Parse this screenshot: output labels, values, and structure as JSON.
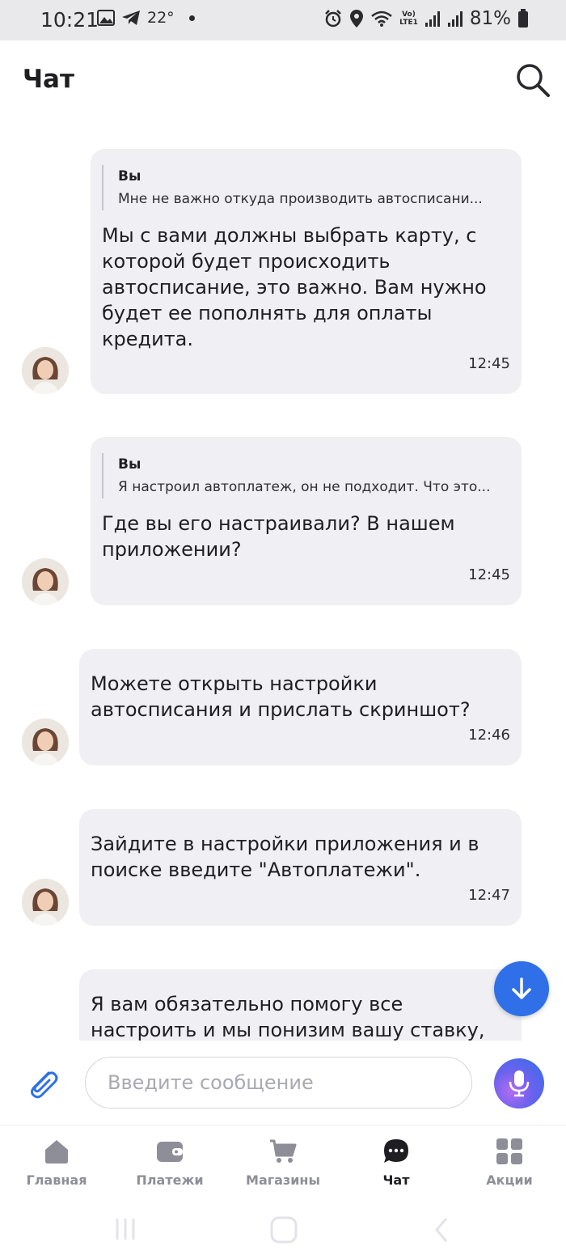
{
  "status_bar": {
    "time": "10:21",
    "temperature": "22°",
    "network_top": "Vo)",
    "network_bottom": "LTE1",
    "battery": "81%"
  },
  "header": {
    "title": "Чат",
    "search_icon": "search-icon"
  },
  "messages": [
    {
      "reply": {
        "author": "Вы",
        "text": "Мне не важно откуда производить автосписани..."
      },
      "text": "Мы с вами должны выбрать карту, с которой будет происходить автосписание, это важно. Вам нужно будет ее пополнять для оплаты кредита.",
      "time": "12:45"
    },
    {
      "reply": {
        "author": "Вы",
        "text": "Я настроил автоплатеж, он не подходит. Что это..."
      },
      "text": "Где вы его настраивали? В нашем приложении?",
      "time": "12:45"
    },
    {
      "text": "Можете открыть настройки автосписания и прислать скриншот?",
      "time": "12:46"
    },
    {
      "text": "Зайдите в настройки приложения и в поиске введите \"Автоплатежи\".",
      "time": "12:47"
    },
    {
      "text": "Я вам обязательно помогу все настроить и мы понизим вашу ставку,"
    }
  ],
  "input": {
    "placeholder": "Введите сообщение",
    "value": ""
  },
  "nav": [
    {
      "label": "Главная",
      "icon": "home-icon"
    },
    {
      "label": "Платежи",
      "icon": "wallet-icon"
    },
    {
      "label": "Магазины",
      "icon": "cart-icon"
    },
    {
      "label": "Чат",
      "icon": "chat-icon",
      "active": true
    },
    {
      "label": "Акции",
      "icon": "grid-icon"
    }
  ],
  "colors": {
    "accent": "#2f6fe8",
    "bubble": "#efeff4",
    "nav_inactive": "#8e8e98"
  }
}
